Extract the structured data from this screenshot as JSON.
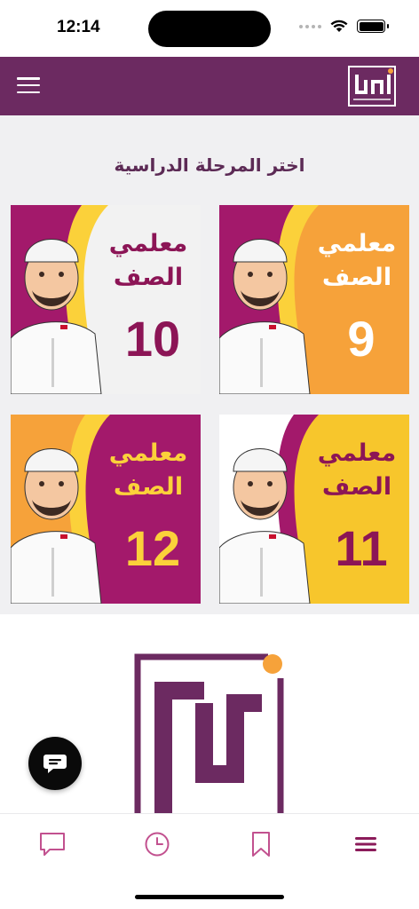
{
  "status_bar": {
    "time": "12:14"
  },
  "header": {
    "logo_icon": "nour-logo"
  },
  "main": {
    "title": "اختر المرحلة الدراسية",
    "cards": [
      {
        "line1": "معلمي",
        "line2": "الصف",
        "number": "10"
      },
      {
        "line1": "معلمي",
        "line2": "الصف",
        "number": "9"
      },
      {
        "line1": "معلمي",
        "line2": "الصف",
        "number": "12"
      },
      {
        "line1": "معلمي",
        "line2": "الصف",
        "number": "11"
      }
    ]
  },
  "tab_bar": {
    "items": [
      {
        "icon": "chat-bubble-icon"
      },
      {
        "icon": "clock-icon"
      },
      {
        "icon": "bookmark-icon"
      },
      {
        "icon": "menu-icon"
      }
    ]
  },
  "colors": {
    "brand_purple": "#6c2a61",
    "magenta": "#a3196b",
    "orange": "#f6a23a",
    "yellow": "#f7c62c",
    "tab_icon": "#c2518f",
    "active_tab": "#8b1b5a"
  }
}
